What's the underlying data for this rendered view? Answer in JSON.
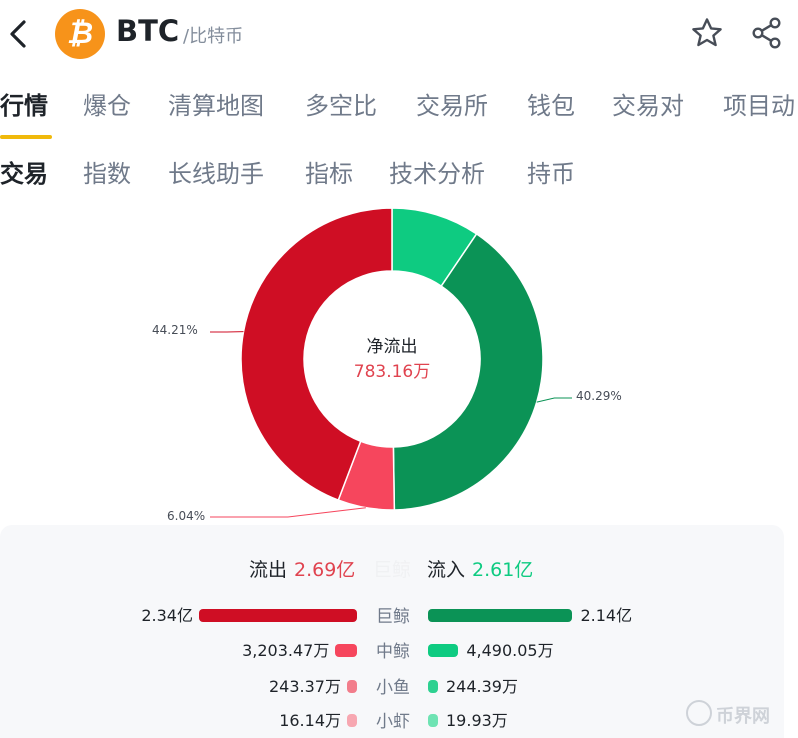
{
  "header": {
    "coin_symbol": "BTC",
    "coin_name": "/比特币",
    "coin_logo_glyph": "₿"
  },
  "tabs_main": [
    {
      "label": "行情",
      "active": true
    },
    {
      "label": "爆仓",
      "active": false
    },
    {
      "label": "清算地图",
      "active": false
    },
    {
      "label": "多空比",
      "active": false
    },
    {
      "label": "交易所",
      "active": false
    },
    {
      "label": "钱包",
      "active": false
    },
    {
      "label": "交易对",
      "active": false
    },
    {
      "label": "项目动",
      "active": false
    }
  ],
  "tabs_sub": [
    {
      "label": "交易",
      "active": true
    },
    {
      "label": "指数",
      "active": false
    },
    {
      "label": "长线助手",
      "active": false
    },
    {
      "label": "指标",
      "active": false
    },
    {
      "label": "技术分析",
      "active": false
    },
    {
      "label": "持币",
      "active": false
    }
  ],
  "donut": {
    "center_label": "净流出",
    "center_value": "783.16万",
    "segments": [
      {
        "key": "inflow_medium",
        "percent": 9.46,
        "color": "#0ecb81",
        "label": ""
      },
      {
        "key": "inflow_whale",
        "percent": 40.29,
        "color": "#0b9356",
        "label": "40.29%"
      },
      {
        "key": "outflow_medium",
        "percent": 6.04,
        "color": "#f6465d",
        "label": "6.04%"
      },
      {
        "key": "outflow_whale",
        "percent": 44.21,
        "color": "#cf0e24",
        "label": "44.21%"
      }
    ]
  },
  "summary": {
    "outflow_label": "流出",
    "outflow_value": "2.69亿",
    "mid_label": "巨鲸",
    "inflow_label": "流入",
    "inflow_value": "2.61亿"
  },
  "rows": [
    {
      "category": "巨鲸",
      "out_value": "2.34亿",
      "in_value": "2.14亿",
      "out_color": "#cf0e24",
      "in_color": "#0b9356",
      "out_amount": 2.34,
      "in_amount": 2.14
    },
    {
      "category": "中鲸",
      "out_value": "3,203.47万",
      "in_value": "4,490.05万",
      "out_color": "#f6465d",
      "in_color": "#0ecb81",
      "out_amount": 0.3203,
      "in_amount": 0.449
    },
    {
      "category": "小鱼",
      "out_value": "243.37万",
      "in_value": "244.39万",
      "out_color": "#f27d8b",
      "in_color": "#2ed191",
      "out_amount": 0.0243,
      "in_amount": 0.0244
    },
    {
      "category": "小虾",
      "out_value": "16.14万",
      "in_value": "19.93万",
      "out_color": "#f7a7b1",
      "in_color": "#6ee3b3",
      "out_amount": 0.0016,
      "in_amount": 0.002
    }
  ],
  "watermark": {
    "text": "币界网",
    "glyph": "₿"
  },
  "icons": [
    "back-icon",
    "star-icon",
    "share-icon"
  ]
}
